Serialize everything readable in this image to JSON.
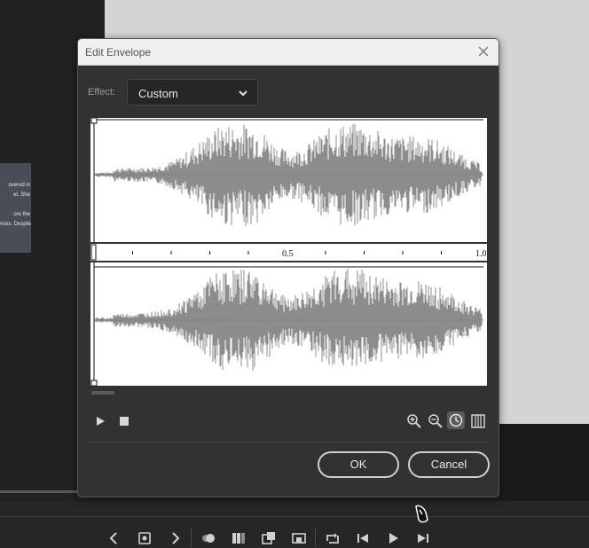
{
  "dialog": {
    "title": "Edit Envelope",
    "effect_label": "Effect:",
    "effect_value": "Custom",
    "ok_label": "OK",
    "cancel_label": "Cancel"
  },
  "waveform": {
    "ruler_labels": [
      "0.5",
      "1.0"
    ],
    "ruler_unit_icon": "clock-icon"
  },
  "controls": {
    "play_icon": "play-icon",
    "stop_icon": "stop-icon",
    "zoom_in_icon": "zoom-in-icon",
    "zoom_out_icon": "zoom-out-icon",
    "seconds_icon": "clock-icon",
    "frames_icon": "frames-icon"
  },
  "background_snippet": {
    "lines": [
      "overed in",
      "et. She",
      "",
      "ore the",
      "risks. Despite"
    ]
  },
  "colors": {
    "dialog_bg": "#323232",
    "waveform": "#808080",
    "canvas": "#d4d4d4"
  }
}
